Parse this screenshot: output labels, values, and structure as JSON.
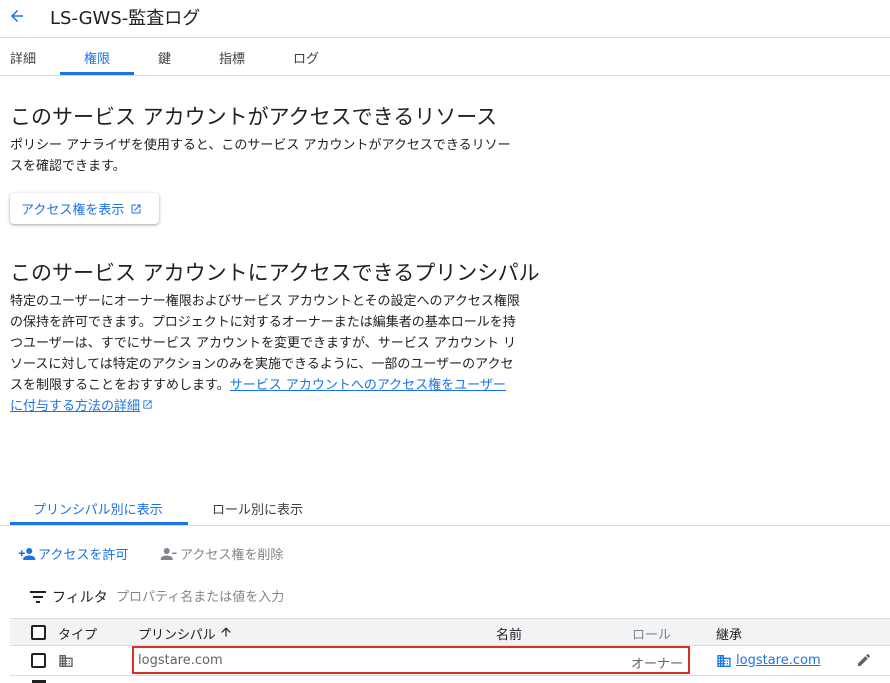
{
  "header": {
    "title": "LS-GWS-監査ログ"
  },
  "tabs": [
    {
      "label": "詳細",
      "active": false
    },
    {
      "label": "権限",
      "active": true
    },
    {
      "label": "鍵",
      "active": false
    },
    {
      "label": "指標",
      "active": false
    },
    {
      "label": "ログ",
      "active": false
    }
  ],
  "resources": {
    "heading": "このサービス アカウントがアクセスできるリソース",
    "desc_line1": "ポリシー アナライザを使用すると、このサービス アカウントがアクセスできるリソー",
    "desc_line2": "スを確認できます。",
    "button_label": "アクセス権を表示"
  },
  "principals": {
    "heading": "このサービス アカウントにアクセスできるプリンシパル",
    "lines": [
      "特定のユーザーにオーナー権限およびサービス アカウントとその設定へのアクセス権限",
      "の保持を許可できます。プロジェクトに対するオーナーまたは編集者の基本ロールを持",
      "つユーザーは、すでにサービス アカウントを変更できますが、サービス アカウント リ",
      "ソースに対しては特定のアクションのみを実施できるように、一部のユーザーのアクセ"
    ],
    "last_line_text": "スを制限することをおすすめします。",
    "link_part1": "サービス アカウントへのアクセス権をユーザー",
    "link_part2": "に付与する方法の詳細"
  },
  "view_tabs": [
    {
      "label": "プリンシパル別に表示",
      "active": true
    },
    {
      "label": "ロール別に表示",
      "active": false
    }
  ],
  "actions": {
    "grant": "アクセスを許可",
    "remove": "アクセス権を削除"
  },
  "filter": {
    "label": "フィルタ",
    "placeholder": "プロパティ名または値を入力"
  },
  "table": {
    "columns": {
      "type": "タイプ",
      "principal": "プリンシパル",
      "name": "名前",
      "role": "ロール",
      "inheritance": "継承"
    },
    "rows": [
      {
        "principal": "logstare.com",
        "name": "",
        "role": "オーナー",
        "inheritance": "logstare.com"
      }
    ]
  },
  "colors": {
    "accent": "#1a73e8",
    "highlight_border": "#d93025",
    "text": "#202124",
    "muted": "#80868b"
  },
  "icons": [
    "arrow-back-icon",
    "open-in-new-icon",
    "person-add-icon",
    "person-remove-icon",
    "filter-list-icon",
    "sort-arrow-up-icon",
    "domain-icon",
    "edit-pencil-icon"
  ]
}
